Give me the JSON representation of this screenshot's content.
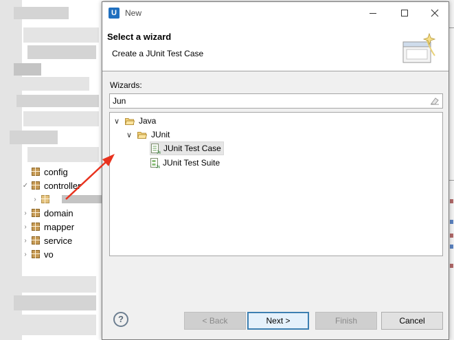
{
  "dialog": {
    "title": "New",
    "app_icon_letter": "U",
    "header_title": "Select a wizard",
    "header_desc": "Create a JUnit Test Case",
    "wizards_label": "Wizards:",
    "filter_value": "Jun",
    "tree": [
      {
        "label": "Java",
        "expanded": true,
        "level": 0,
        "icon": "folder-icon"
      },
      {
        "label": "JUnit",
        "expanded": true,
        "level": 1,
        "icon": "folder-icon"
      },
      {
        "label": "JUnit Test Case",
        "level": 2,
        "icon": "junit-test-case-icon",
        "selected": true
      },
      {
        "label": "JUnit Test Suite",
        "level": 2,
        "icon": "junit-test-suite-icon",
        "selected": false
      }
    ],
    "buttons": {
      "help": "?",
      "back": "< Back",
      "next": "Next >",
      "finish": "Finish",
      "cancel": "Cancel"
    }
  },
  "ide": {
    "packages": [
      {
        "label": "config",
        "twisty": ""
      },
      {
        "label": "controller",
        "twisty": "expanded"
      },
      {
        "label": "domain",
        "twisty": "collapsed"
      },
      {
        "label": "mapper",
        "twisty": "collapsed"
      },
      {
        "label": "service",
        "twisty": "collapsed"
      },
      {
        "label": "vo",
        "twisty": "collapsed"
      }
    ]
  },
  "colors": {
    "accent": "#3c7fb1",
    "arrow": "#e8321e",
    "selection": "#e6e6e6"
  }
}
